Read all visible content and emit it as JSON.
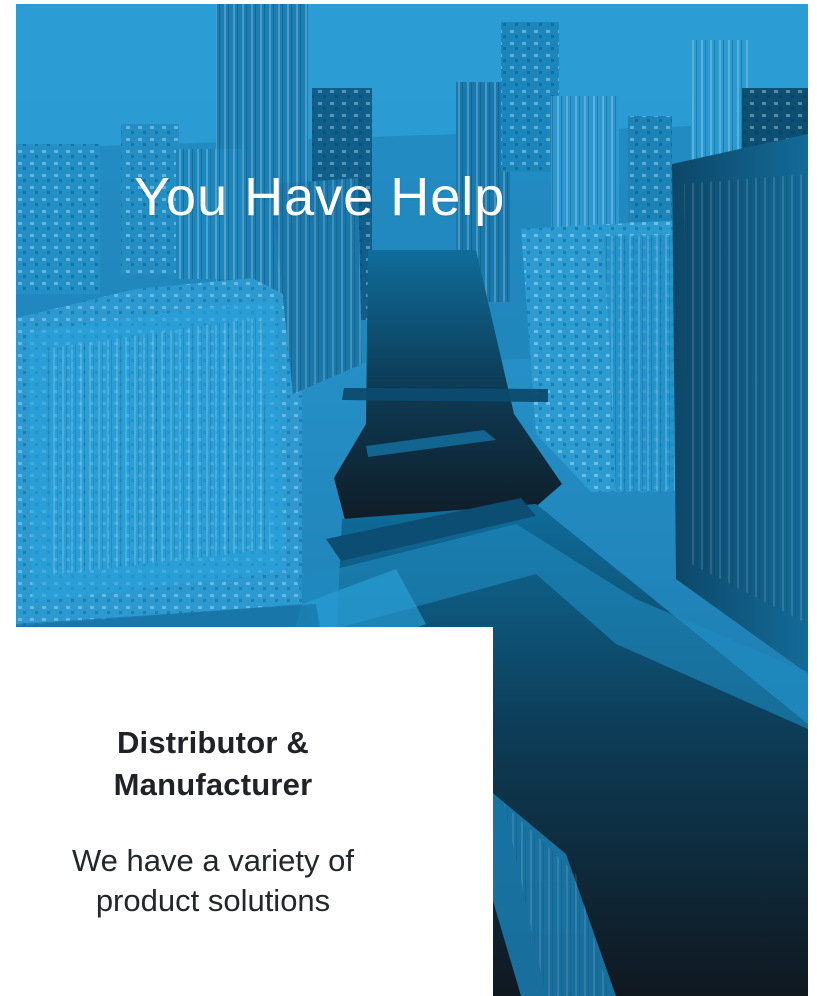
{
  "hero": {
    "headline": "You Have Help",
    "image": "city-river-aerial-image"
  },
  "panel": {
    "title": "Distributor & Manufacturer",
    "body": "We have a variety of product solutions"
  },
  "colors": {
    "overlay_blue": "#2d9bd3",
    "dark_water": "#101820",
    "panel_bg": "#ffffff",
    "text_dark": "#1f2328",
    "text_light": "#ffffff"
  }
}
